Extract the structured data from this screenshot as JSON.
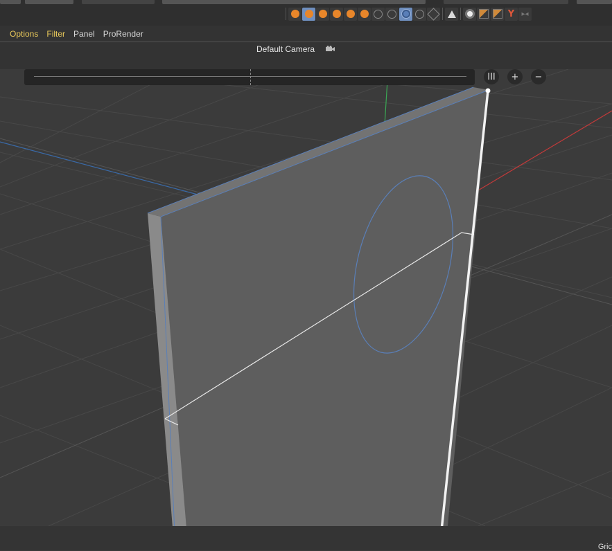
{
  "menubar": {
    "options": "Options",
    "filter": "Filter",
    "panel": "Panel",
    "prorender": "ProRender"
  },
  "viewport": {
    "camera_label": "Default Camera"
  },
  "timeline_controls": {
    "columns_button": "III",
    "zoom_in_button": "+",
    "zoom_out_button": "−"
  },
  "status_bar": {
    "grid_label": "Gric"
  },
  "colors": {
    "accent_highlight": "#e8c85a",
    "axis_x": "#c23a3a",
    "axis_y": "#3aaa55",
    "axis_z": "#3a6aa8",
    "edge_highlight": "#5a7fb8",
    "render_orange": "#e8862a"
  },
  "toolbar_icons": [
    "sphere-solid-icon",
    "sphere-selected-icon",
    "sphere-solid-icon",
    "sphere-solid-icon",
    "sphere-solid-icon",
    "sphere-solid-icon",
    "sphere-wire-icon",
    "sphere-wire-icon",
    "sphere-grid-selected-icon",
    "sphere-wire-icon",
    "hexagon-icon",
    "triangle-icon",
    "light-icon",
    "material-icon",
    "material-mix-icon",
    "y-shape-icon",
    "arrow-icon"
  ]
}
